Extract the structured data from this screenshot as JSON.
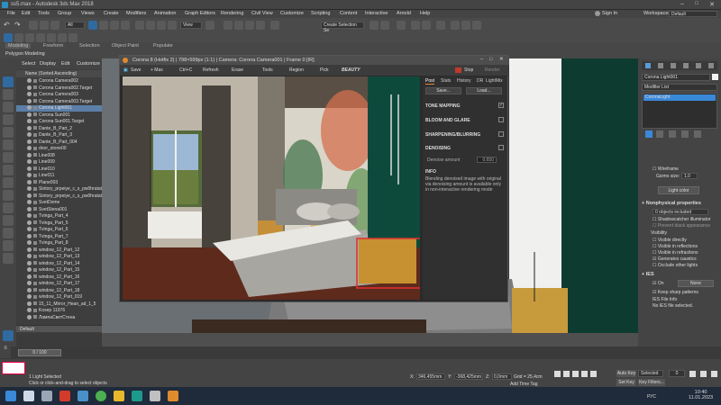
{
  "window_title": "ss5.max - Autodesk 3ds Max 2018",
  "menu": [
    "File",
    "Edit",
    "Tools",
    "Group",
    "Views",
    "Create",
    "Modifiers",
    "Animation",
    "Graph Editors",
    "Rendering",
    "Civil View",
    "Customize",
    "Scripting",
    "Content",
    "Interactive",
    "Arnold",
    "Help"
  ],
  "sign_in": "Sign In",
  "workspaces_label": "Workspaces:",
  "workspaces_value": "Default",
  "ribbon": [
    "Modeling",
    "Freeform",
    "Selection",
    "Object Paint",
    "Populate"
  ],
  "polygon_modeling": "Polygon Modeling",
  "create_selection_set": "Create Selection Se",
  "explorer": {
    "tabs": [
      "Select",
      "Display",
      "Edit",
      "Customize"
    ],
    "column_header": "Name (Sorted Ascending)",
    "items": [
      "Corona Camera002",
      "Corona Camera002.Target",
      "Corona Camera003",
      "Corona Camera003.Target",
      "Corona Light001",
      "Corona Sun001",
      "Corona Sun001.Target",
      "Dante_B_Part_2",
      "Dante_B_Part_3",
      "Dante_B_Part_004",
      "door_stone00",
      "Line008",
      "Line009",
      "Line010",
      "Line011",
      "Plane003",
      "Sintory_prpeiye_c_s_pw0hratat",
      "Sintory_prpeiye_c_s_pw0hratat",
      "SvetDome",
      "SvetStena001",
      "Tvinga_Part_4",
      "Tvinga_Part_5",
      "Tvinga_Part_6",
      "Tvinga_Part_7",
      "Tvinga_Part_8",
      "window_12_Part_12",
      "window_12_Part_13",
      "window_12_Part_14",
      "window_12_Part_15",
      "window_12_Part_16",
      "window_12_Part_17",
      "window_12_Part_18",
      "window_12_Part_019",
      "15_11_Mirror_Hean_ad_1_5",
      "Kosep 11976",
      "ЛампаСветСтена"
    ],
    "layer": "Default"
  },
  "vfb": {
    "title": "Corona 8 (Hotfix 2) | 798×599px (1:1) | Camera: Corona Camera001 | Frame 0 [IR]",
    "toolbar": [
      "Save",
      "+ Max",
      "Ctrl+C",
      "Refresh",
      "Erase",
      "Tools",
      "Region",
      "Pick",
      "BEAUTY",
      "Stop",
      "Render"
    ],
    "tabs": [
      "Post",
      "Stats",
      "History",
      "DR",
      "LightMix"
    ],
    "save_btn": "Save...",
    "load_btn": "Load...",
    "sections": [
      "TONE MAPPING",
      "BLOOM AND GLARE",
      "SHARPENING/BLURRING",
      "DENOISING"
    ],
    "denoise_label": "Denoise amount",
    "denoise_value": "0.650",
    "info_header": "INFO",
    "info_text": "Blending denoised image with original via denoising amount is available only in non-interactive rendering mode"
  },
  "command_panel": {
    "object_name": "Corona Light001",
    "modifier_list": "Modifier List",
    "stack_item": "CoronaLight",
    "wireframe": "Wireframe",
    "gizmo_size_label": "Gizmo size:",
    "gizmo_size_value": "1.0",
    "light_color_btn": "Light color",
    "nonphysical_header": "Nonphysical properties",
    "objects_included": "0 objects included",
    "shadowcatcher": "Shadowcatcher illuminator",
    "prevent_black": "Prevent black appearance",
    "visibility": "Visibility",
    "vis_opts": [
      "Visible directly",
      "Visible in reflections",
      "Visible in refractions",
      "Generates caustics",
      "Occlude other lights"
    ],
    "ies_header": "IES",
    "ies_on": "On",
    "ies_none": "None",
    "keep_sharp": "Keep sharp patterns",
    "ies_file_info": "IES File Info",
    "no_ies": "No IES file selected."
  },
  "timeline": {
    "frame": "0 / 100"
  },
  "status": {
    "selected": "1 Light Selected",
    "hint": "Click or click-and-drag to select objects",
    "x_label": "X:",
    "x_value": "346,455mm",
    "y_label": "Y:",
    "y_value": "-368,425mm",
    "z_label": "Z:",
    "z_value": "0,0mm",
    "grid": "Grid = 25,4cm",
    "add_time_tag": "Add Time Tag",
    "auto_key": "Auto Key",
    "selected_dd": "Selected",
    "set_key": "Set Key",
    "key_filters": "Key Filters...",
    "frame_value": "0"
  },
  "taskbar": {
    "time": "10:40",
    "date": "11.01.2023",
    "lang": "РУС"
  },
  "colors": {
    "accent": "#3a88d8",
    "wall_green": "#0e3b30",
    "selection_red": "#e03030"
  }
}
